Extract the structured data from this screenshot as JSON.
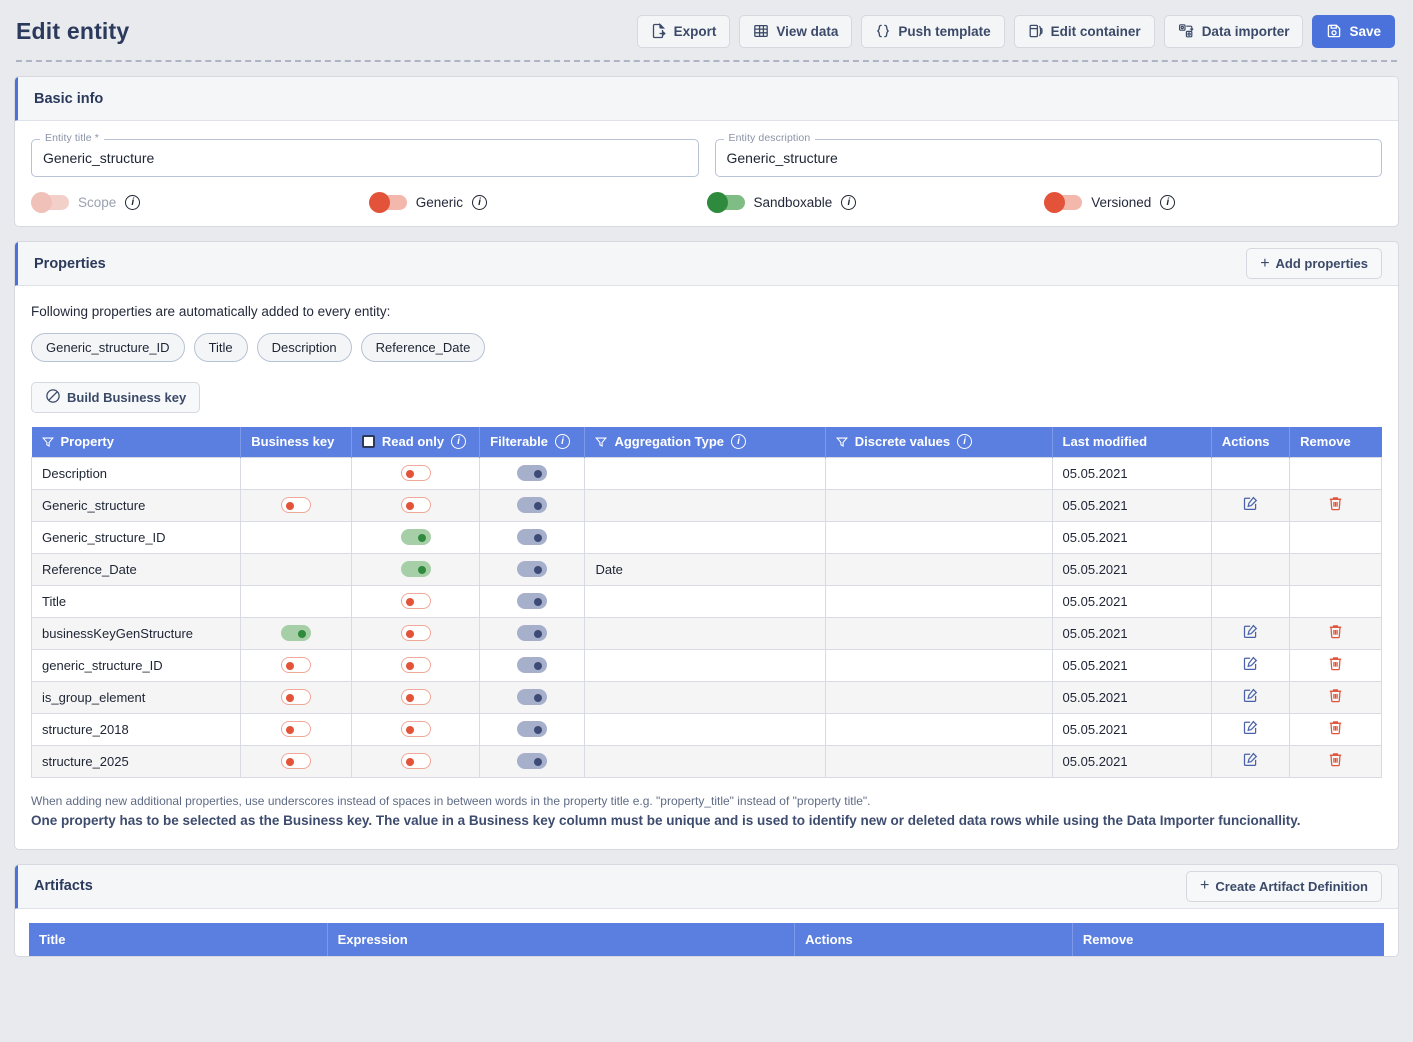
{
  "header": {
    "title": "Edit entity",
    "actions": [
      {
        "label": "Export",
        "icon": "export-icon",
        "primary": false
      },
      {
        "label": "View data",
        "icon": "table-icon",
        "primary": false
      },
      {
        "label": "Push template",
        "icon": "braces-icon",
        "primary": false
      },
      {
        "label": "Edit container",
        "icon": "container-icon",
        "primary": false
      },
      {
        "label": "Data importer",
        "icon": "data-importer-icon",
        "primary": false
      },
      {
        "label": "Save",
        "icon": "save-icon",
        "primary": true
      }
    ]
  },
  "basic_info": {
    "section_title": "Basic info",
    "entity_title": {
      "label": "Entity title *",
      "value": "Generic_structure"
    },
    "entity_description": {
      "label": "Entity description",
      "value": "Generic_structure"
    },
    "toggles": [
      {
        "label": "Scope",
        "state": "off-disabled",
        "info": "i"
      },
      {
        "label": "Generic",
        "state": "off-red",
        "info": "i"
      },
      {
        "label": "Sandboxable",
        "state": "on-green",
        "info": "i"
      },
      {
        "label": "Versioned",
        "state": "off-red",
        "info": "i"
      }
    ]
  },
  "properties": {
    "section_title": "Properties",
    "add_button": "Add properties",
    "auto_text": "Following properties are automatically added to every entity:",
    "chips": [
      "Generic_structure_ID",
      "Title",
      "Description",
      "Reference_Date"
    ],
    "build_button": "Build Business key",
    "columns": [
      {
        "label": "Property",
        "filter": true,
        "info": false,
        "checkbox": false
      },
      {
        "label": "Business key",
        "filter": false,
        "info": false,
        "checkbox": false
      },
      {
        "label": "Read only",
        "filter": false,
        "info": true,
        "checkbox": true
      },
      {
        "label": "Filterable",
        "filter": false,
        "info": true,
        "checkbox": false
      },
      {
        "label": "Aggregation Type",
        "filter": true,
        "info": true,
        "checkbox": false
      },
      {
        "label": "Discrete values",
        "filter": true,
        "info": true,
        "checkbox": false
      },
      {
        "label": "Last modified",
        "filter": false,
        "info": false,
        "checkbox": false
      },
      {
        "label": "Actions",
        "filter": false,
        "info": false,
        "checkbox": false
      },
      {
        "label": "Remove",
        "filter": false,
        "info": false,
        "checkbox": false
      }
    ],
    "rows": [
      {
        "property": "Description",
        "business_key": "",
        "read_only": "red",
        "filterable": "blue",
        "aggregation": "",
        "discrete": "",
        "last_modified": "05.05.2021",
        "edit": false,
        "remove": false
      },
      {
        "property": "Generic_structure",
        "business_key": "red",
        "read_only": "red",
        "filterable": "blue",
        "aggregation": "",
        "discrete": "",
        "last_modified": "05.05.2021",
        "edit": true,
        "remove": true
      },
      {
        "property": "Generic_structure_ID",
        "business_key": "",
        "read_only": "green",
        "filterable": "blue",
        "aggregation": "",
        "discrete": "",
        "last_modified": "05.05.2021",
        "edit": false,
        "remove": false
      },
      {
        "property": "Reference_Date",
        "business_key": "",
        "read_only": "green",
        "filterable": "blue",
        "aggregation": "Date",
        "discrete": "",
        "last_modified": "05.05.2021",
        "edit": false,
        "remove": false
      },
      {
        "property": "Title",
        "business_key": "",
        "read_only": "red",
        "filterable": "blue",
        "aggregation": "",
        "discrete": "",
        "last_modified": "05.05.2021",
        "edit": false,
        "remove": false
      },
      {
        "property": "businessKeyGenStructure",
        "business_key": "green",
        "read_only": "red",
        "filterable": "blue",
        "aggregation": "",
        "discrete": "",
        "last_modified": "05.05.2021",
        "edit": true,
        "remove": true
      },
      {
        "property": "generic_structure_ID",
        "business_key": "red",
        "read_only": "red",
        "filterable": "blue",
        "aggregation": "",
        "discrete": "",
        "last_modified": "05.05.2021",
        "edit": true,
        "remove": true
      },
      {
        "property": "is_group_element",
        "business_key": "red",
        "read_only": "red",
        "filterable": "blue",
        "aggregation": "",
        "discrete": "",
        "last_modified": "05.05.2021",
        "edit": true,
        "remove": true
      },
      {
        "property": "structure_2018",
        "business_key": "red",
        "read_only": "red",
        "filterable": "blue",
        "aggregation": "",
        "discrete": "",
        "last_modified": "05.05.2021",
        "edit": true,
        "remove": true
      },
      {
        "property": "structure_2025",
        "business_key": "red",
        "read_only": "red",
        "filterable": "blue",
        "aggregation": "",
        "discrete": "",
        "last_modified": "05.05.2021",
        "edit": true,
        "remove": true
      }
    ],
    "note_1": "When adding new additional properties, use underscores instead of spaces in between words in the property title e.g. \"property_title\" instead of \"property title\".",
    "note_2": "One property has to be selected as the Business key. The value in a Business key column must be unique and is used to identify new or deleted data rows while using the Data Importer funcionallity."
  },
  "artifacts": {
    "section_title": "Artifacts",
    "create_button": "Create Artifact Definition",
    "columns": [
      "Title",
      "Expression",
      "Actions",
      "Remove"
    ],
    "rows": []
  },
  "colors": {
    "accent_blue": "#4a72da",
    "header_blue": "#5b7fe0",
    "title_navy": "#2b3a5c",
    "danger_red": "#e2533a",
    "success_green": "#2e8b3d",
    "page_bg": "#e8eaed"
  }
}
